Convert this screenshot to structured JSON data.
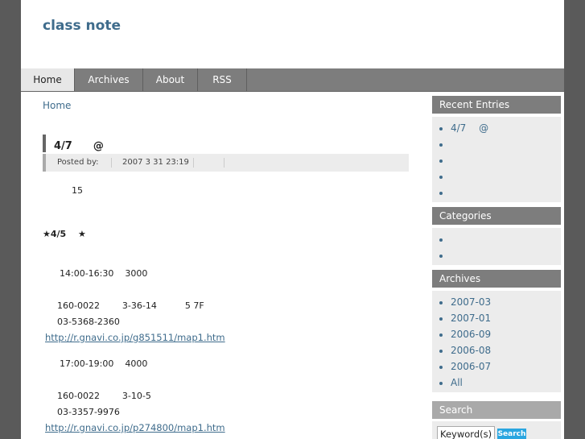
{
  "site": {
    "title": "class note"
  },
  "nav": {
    "tabs": [
      "Home",
      "Archives",
      "About",
      "RSS"
    ],
    "active": "Home"
  },
  "breadcrumb": "Home",
  "entry": {
    "title": "4/7　　@",
    "posted_by_label": "Posted by:",
    "date": "2007 3 31  23:19",
    "lines": {
      "l1": "15",
      "l2": "★4/5　 ★",
      "l3": "14:00-16:30    3000",
      "l4": "160-0022        3-36-14          5 7F",
      "l5": "03-5368-2360",
      "link1": "http://r.gnavi.co.jp/g851511/map1.htm",
      "l6": "17:00-19:00    4000",
      "l7": "160-0022        3-10-5",
      "l8": "03-3357-9976",
      "link2": "http://r.gnavi.co.jp/p274800/map1.htm"
    }
  },
  "sidebar": {
    "recent": {
      "title": "Recent Entries",
      "items": [
        "4/7　 @",
        "",
        "",
        "",
        ""
      ]
    },
    "categories": {
      "title": "Categories",
      "items": [
        "",
        ""
      ]
    },
    "archives": {
      "title": "Archives",
      "items": [
        "2007-03",
        "2007-01",
        "2006-09",
        "2006-08",
        "2006-07",
        "All"
      ]
    },
    "search": {
      "title": "Search",
      "placeholder": "Keyword(s)",
      "button": "Search"
    }
  },
  "colors": {
    "link": "#3f6c8c",
    "nav": "#7d7d7d",
    "background": "#5a5a5a",
    "search_button": "#2aa6e0"
  }
}
